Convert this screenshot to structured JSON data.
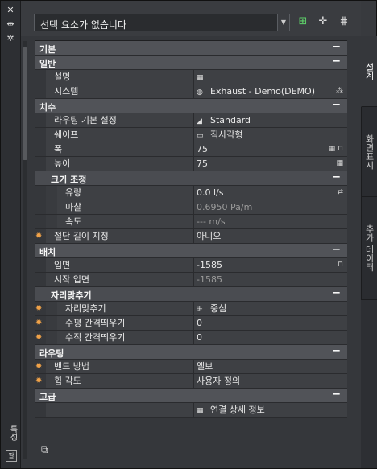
{
  "left_strip": {
    "icons": [
      "close-icon",
      "pin-icon",
      "settings-icon"
    ],
    "label": "특성",
    "bottom_label": "팔"
  },
  "toolbar": {
    "selection": "선택 요소가 없습니다",
    "buttons": [
      "add-object-icon",
      "select-objects-icon",
      "quick-select-icon"
    ]
  },
  "right_tabs": [
    {
      "label": "설계",
      "active": true
    },
    {
      "label": "화면표시",
      "active": false
    },
    {
      "label": "추가 데이터",
      "active": false
    }
  ],
  "grid": {
    "rows": [
      {
        "type": "cat",
        "name": "기본"
      },
      {
        "type": "cat",
        "name": "일반"
      },
      {
        "type": "prop",
        "key": "설명",
        "value": "",
        "value_icon": "▦"
      },
      {
        "type": "prop",
        "key": "시스템",
        "value": "Exhaust - Demo(DEMO)",
        "value_icon": "◍",
        "right_icon": "⁂"
      },
      {
        "type": "cat",
        "name": "치수"
      },
      {
        "type": "prop",
        "key": "라우팅 기본 설정",
        "value": "Standard",
        "value_icon": "◢"
      },
      {
        "type": "prop",
        "key": "쉐이프",
        "value": "직사각형",
        "value_icon": "▭"
      },
      {
        "type": "prop",
        "key": "폭",
        "value": "75",
        "right_icon": "▦ ⊓"
      },
      {
        "type": "prop",
        "key": "높이",
        "value": "75",
        "right_icon": "▦"
      },
      {
        "type": "sub",
        "name": "크기 조정"
      },
      {
        "type": "prop",
        "deep": true,
        "key": "유량",
        "value": "0.0 l/s",
        "right_icon": "⇄"
      },
      {
        "type": "prop",
        "deep": true,
        "key": "마찰",
        "value": "0.6950 Pa/m",
        "dim": true
      },
      {
        "type": "prop",
        "deep": true,
        "key": "속도",
        "value": "--- m/s",
        "dim": true
      },
      {
        "type": "prop",
        "key": "절단 길이 지정",
        "value": "아니오",
        "star": true
      },
      {
        "type": "cat",
        "name": "배치"
      },
      {
        "type": "prop",
        "key": "입면",
        "value": "-1585",
        "right_icon": "⊓"
      },
      {
        "type": "prop",
        "key": "시작 입면",
        "value": "-1585",
        "dim": true
      },
      {
        "type": "sub",
        "name": "자리맞추기"
      },
      {
        "type": "prop",
        "deep": true,
        "key": "자리맞추기",
        "value": "중심",
        "value_icon": "⁜",
        "star": true
      },
      {
        "type": "prop",
        "deep": true,
        "key": "수평 간격띄우기",
        "value": "0",
        "star": true
      },
      {
        "type": "prop",
        "deep": true,
        "key": "수직 간격띄우기",
        "value": "0",
        "star": true
      },
      {
        "type": "cat",
        "name": "라우팅"
      },
      {
        "type": "prop",
        "key": "밴드 방법",
        "value": "엘보",
        "star": true
      },
      {
        "type": "prop",
        "key": "휨 각도",
        "value": "사용자 정의",
        "star": true
      },
      {
        "type": "cat",
        "name": "고급"
      },
      {
        "type": "prop",
        "key": "",
        "value": "연결 상세 정보",
        "value_icon": "▦"
      }
    ]
  },
  "colors": {
    "star": "#f0a248",
    "category_bg": "#515358",
    "row_bg": "#3e4044"
  }
}
